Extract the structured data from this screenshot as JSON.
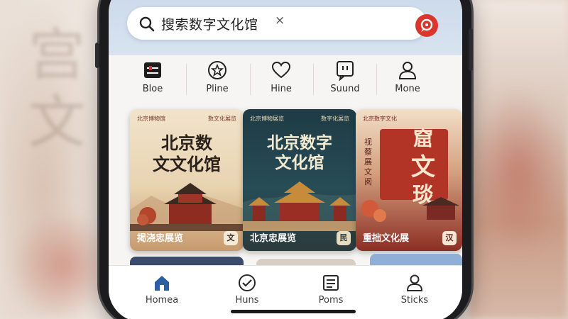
{
  "search": {
    "text": "搜索数字文化馆",
    "clear_glyph": "×"
  },
  "categories": [
    {
      "label": "Bloe",
      "icon": "sliders-icon"
    },
    {
      "label": "Pline",
      "icon": "star-circle-icon"
    },
    {
      "label": "Hine",
      "icon": "heart-icon"
    },
    {
      "label": "Suund",
      "icon": "speech-bubble-icon"
    },
    {
      "label": "Mone",
      "icon": "person-icon"
    }
  ],
  "cards": [
    {
      "header": "北京博物馆",
      "header_right": "数文化展览",
      "title_line1": "北京数",
      "title_line2": "文文化馆",
      "footer": "掲浇忠展览",
      "badge": "文"
    },
    {
      "header": "北京博物展览",
      "header_right": "数字化展览",
      "title_line1": "北京数字",
      "title_line2": "文化馆",
      "footer": "北京忠展览",
      "badge": "民"
    },
    {
      "header": "北京数字文化",
      "title_big1": "窟",
      "title_big2": "文",
      "title_big3": "琰",
      "side_text": "视蔡展文阅",
      "footer": "重拙文化展",
      "badge": "汉"
    }
  ],
  "nav": [
    {
      "label": "Homea",
      "icon": "home-icon",
      "active": true
    },
    {
      "label": "Huns",
      "icon": "check-circle-icon",
      "active": false
    },
    {
      "label": "Poms",
      "icon": "list-box-icon",
      "active": false
    },
    {
      "label": "Sticks",
      "icon": "person-icon",
      "active": false
    }
  ],
  "colors": {
    "accent_blue": "#2f5fa3",
    "mic_red": "#d9372e",
    "topbar": "#c9d8ea"
  }
}
